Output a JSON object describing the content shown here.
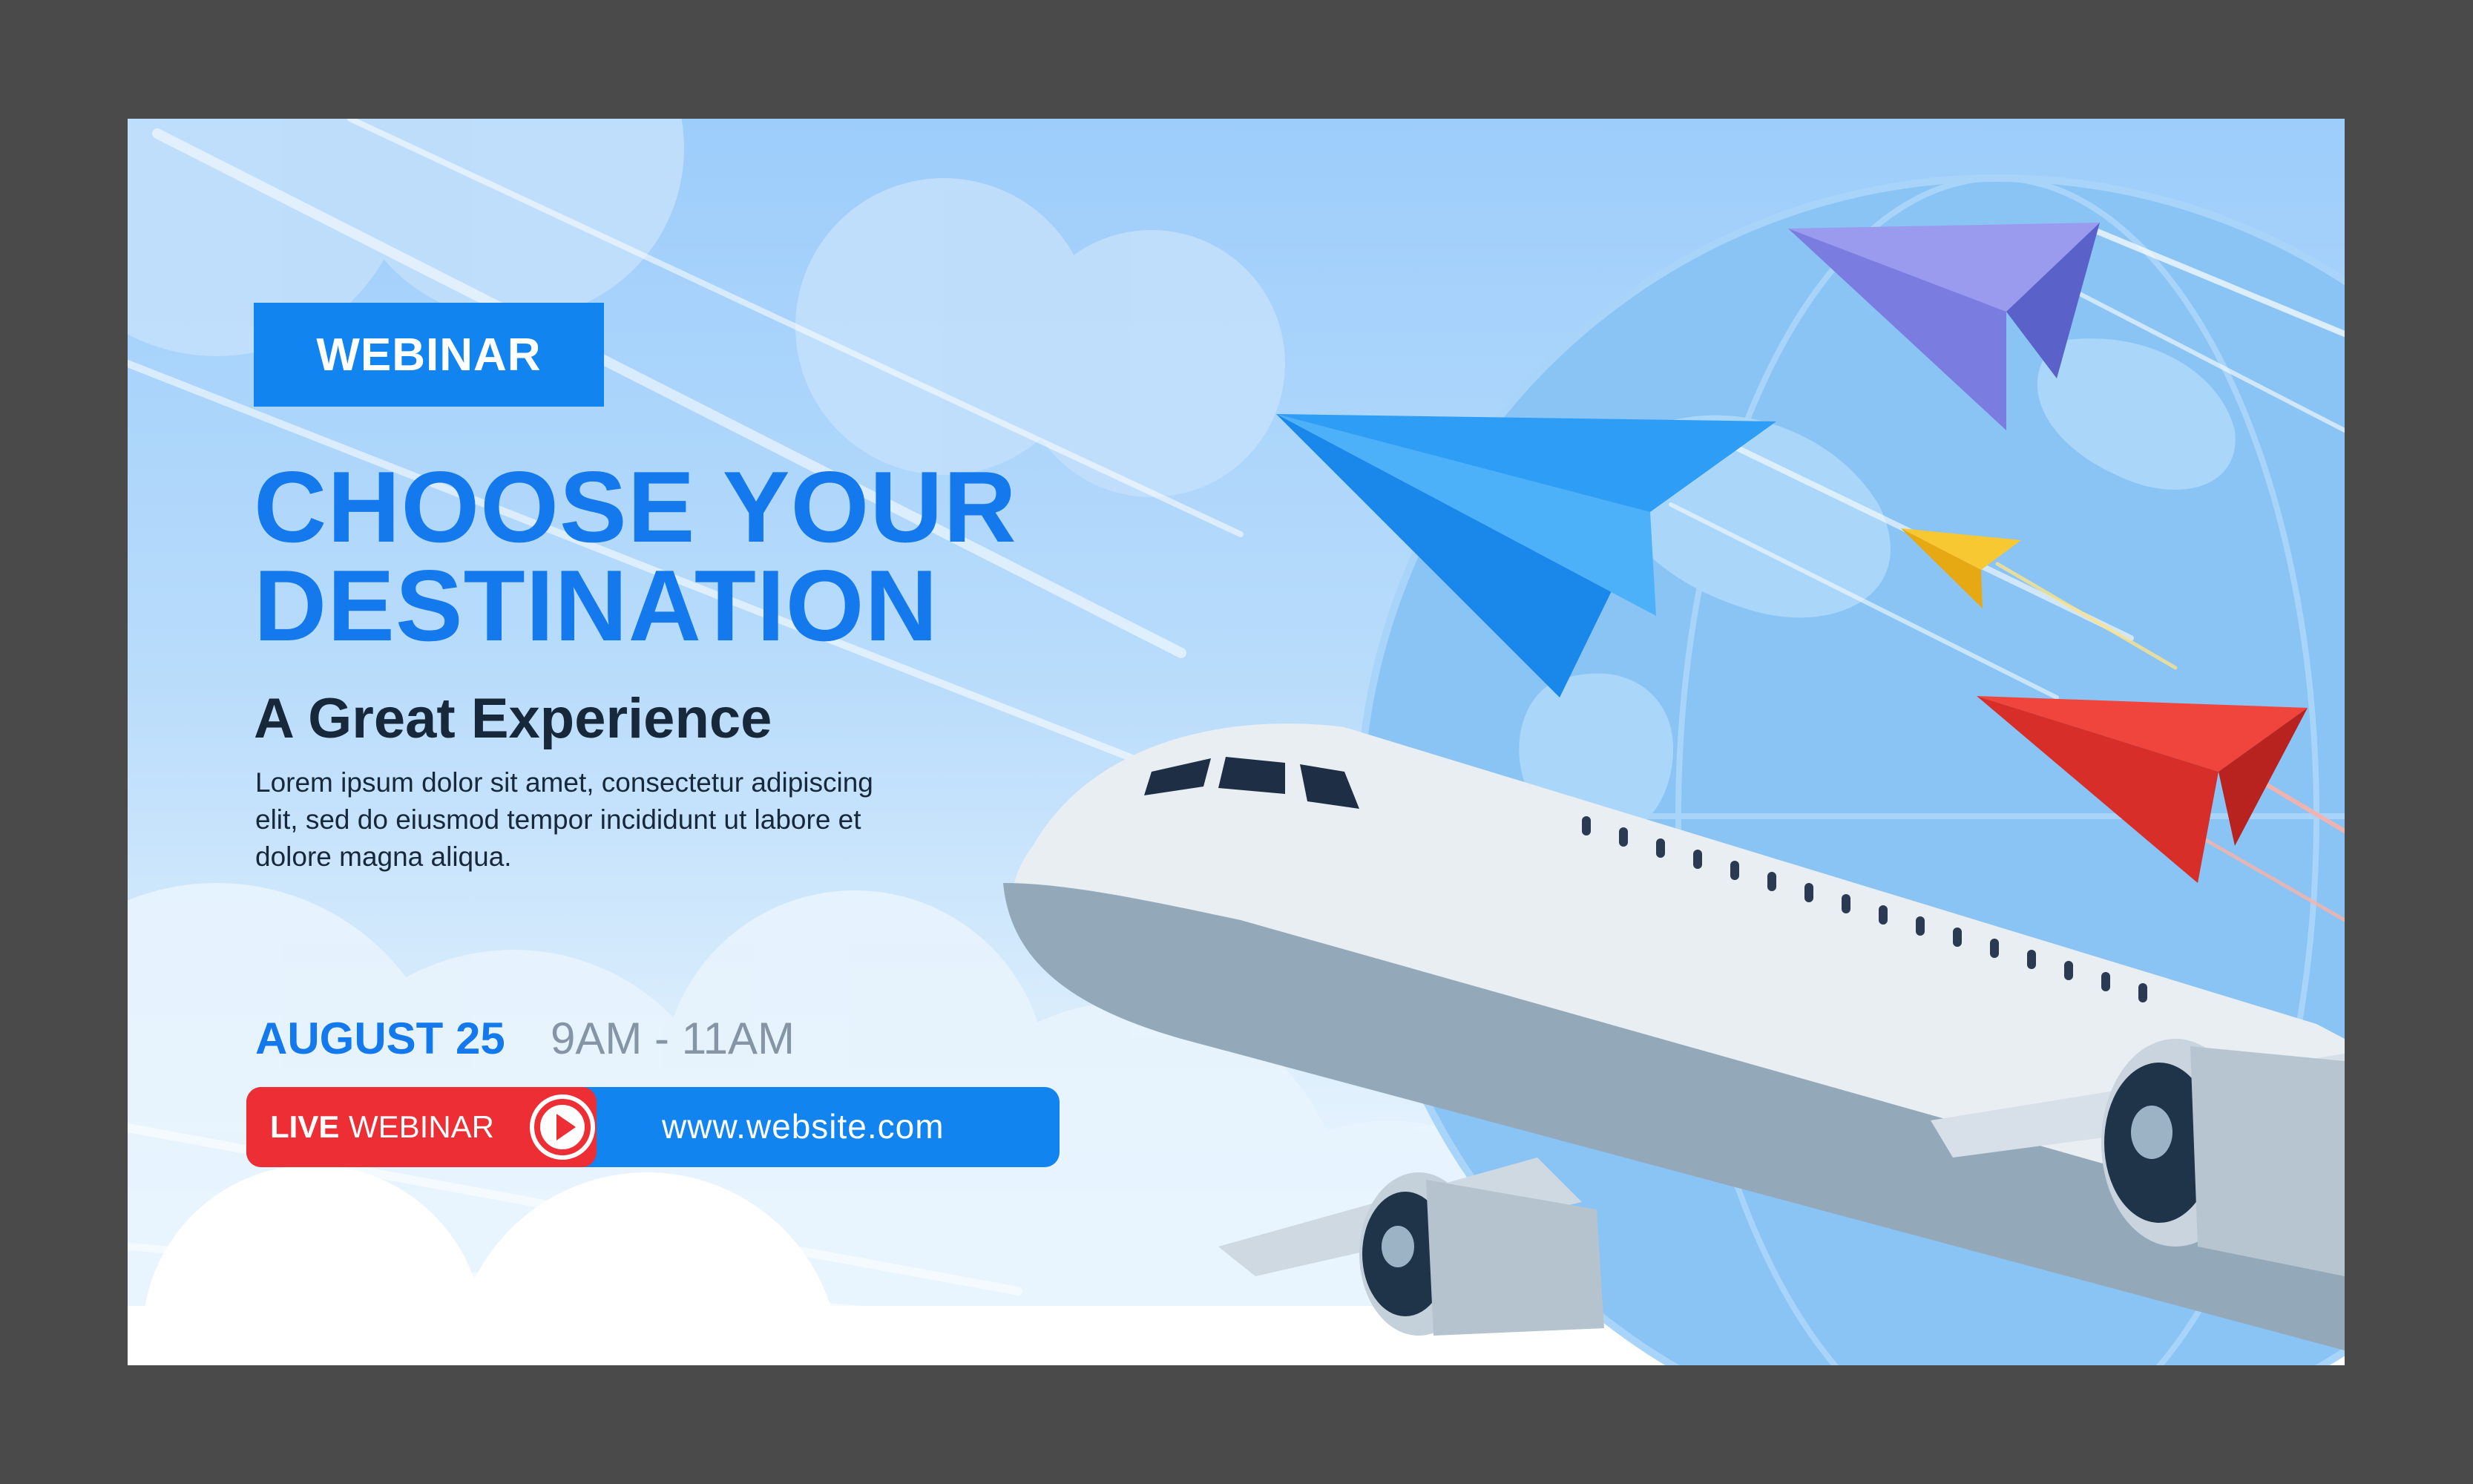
{
  "colors": {
    "accent": "#1184f0",
    "headline": "#1379ec",
    "live_red": "#ee2e35",
    "frame": "#4b4a4b"
  },
  "tag": {
    "label": "WEBINAR"
  },
  "headline": {
    "line1": "CHOOSE YOUR",
    "line2": "DESTINATION"
  },
  "subtitle": "A Great Experience",
  "body": "Lorem ipsum dolor sit amet, consectetur adipiscing elit, sed do eiusmod tempor incididunt ut labore et dolore magna aliqua.",
  "schedule": {
    "date": "AUGUST 25",
    "time": "9AM - 11AM"
  },
  "cta": {
    "live_label": "LIVE",
    "webinar_label": "WEBINAR",
    "play_icon": "play-icon",
    "url": "www.website.com"
  },
  "illustration": {
    "icons": [
      "airplane-illustration",
      "paper-plane-icon",
      "globe-illustration",
      "cloud-illustration"
    ]
  }
}
